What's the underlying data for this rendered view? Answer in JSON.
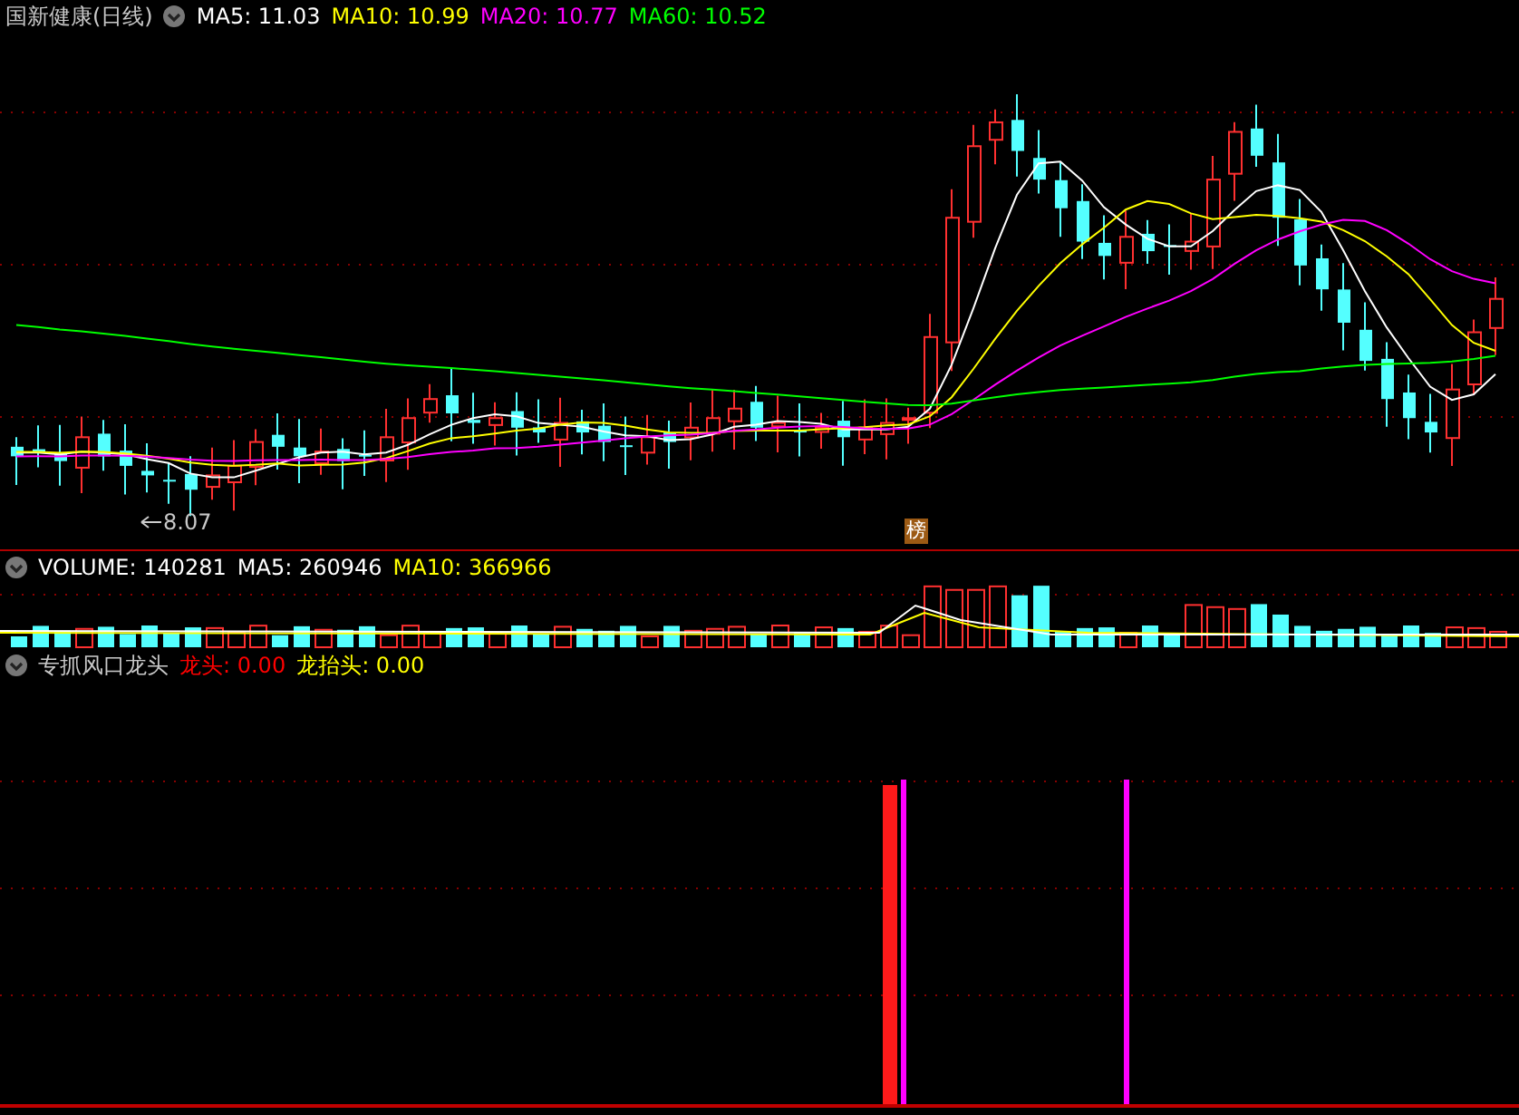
{
  "title": "国新健康(日线)",
  "main_indicators": [
    {
      "label": "MA5: 11.03",
      "color": "#ffffff"
    },
    {
      "label": "MA10: 10.99",
      "color": "#ffff00"
    },
    {
      "label": "MA20: 10.77",
      "color": "#ff00ff"
    },
    {
      "label": "MA60: 10.52",
      "color": "#00ff00"
    }
  ],
  "low_marker": "8.07",
  "badge": "榜",
  "volume_panel": {
    "label": "VOLUME: 140281",
    "indicators": [
      {
        "label": "MA5: 260946",
        "color": "#ffffff"
      },
      {
        "label": "MA10: 366966",
        "color": "#ffff00"
      }
    ]
  },
  "signal_panel": {
    "label": "专抓风口龙头",
    "indicators": [
      {
        "label": "龙头: 0.00",
        "color": "#ff0000"
      },
      {
        "label": "龙抬头: 0.00",
        "color": "#ffff00"
      }
    ]
  }
}
